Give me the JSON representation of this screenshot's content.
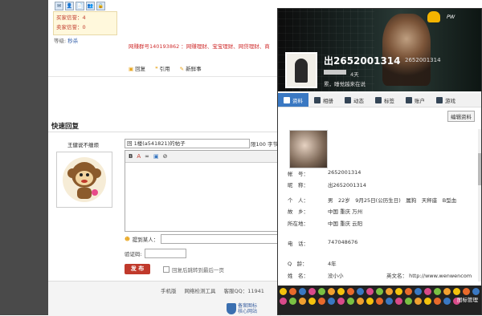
{
  "forum": {
    "tiny_icons": [
      "✉",
      "👤",
      "📄",
      "👥",
      "🔒"
    ],
    "stats": {
      "buyer_credit": "买家信誉：4",
      "seller_credit": "卖家信誉：0"
    },
    "rank_label": "等级:",
    "rank_value": "秒杀",
    "ad_text": "网赚群号140193862 ：网赚理财、宝宝理财、网贷理财、商",
    "post_buttons": [
      "回复",
      "引用",
      "新鲜事"
    ],
    "quick_reply_title": "快速回复",
    "username": "王健说不缠烦",
    "subject_value": "回 1楼(a541821)的帖子",
    "limit_text": "限100 字节",
    "toolbar_items": [
      "B",
      "A",
      "∞",
      "▣",
      "⊘"
    ],
    "mention_label": "提到某人：",
    "captcha_label": "验证码:",
    "submit_label": "发 布",
    "checkbox_label": "回复后跳转到最后一页",
    "footer_links": [
      "手机版",
      "网络检测工具",
      "客服QQ：11941"
    ],
    "footer_badge": "备案图标\n核心网站"
  },
  "profile": {
    "brand": "PW",
    "name": "出2652001314",
    "name_small": "2652001314",
    "days": "4天",
    "status": "累，睡觉越来在说",
    "tabs": [
      "资料",
      "相册",
      "动态",
      "标签",
      "账户",
      "游戏"
    ],
    "active_tab": "资料",
    "edit_button": "编辑资料",
    "fields": [
      {
        "k": "帐　号：",
        "v": "2652001314"
      },
      {
        "k": "昵　称：",
        "v": "出2652001314"
      },
      {
        "k": "个　人：",
        "v": "男　22岁　9月25日(公历生日)　属狗　天秤座　B型血"
      },
      {
        "k": "故　乡：",
        "v": "中国 重庆 万州"
      },
      {
        "k": "所在地：",
        "v": "中国 重庆 云阳"
      },
      {
        "k": "电　话：",
        "v": "747048676"
      },
      {
        "k": "Q　龄：",
        "v": "4年"
      },
      {
        "k": "姓　名：",
        "v": "没小小"
      }
    ],
    "english_label": "英文名：",
    "homepage": "http://www.wenwencom",
    "emote_manage": "图标管理"
  }
}
